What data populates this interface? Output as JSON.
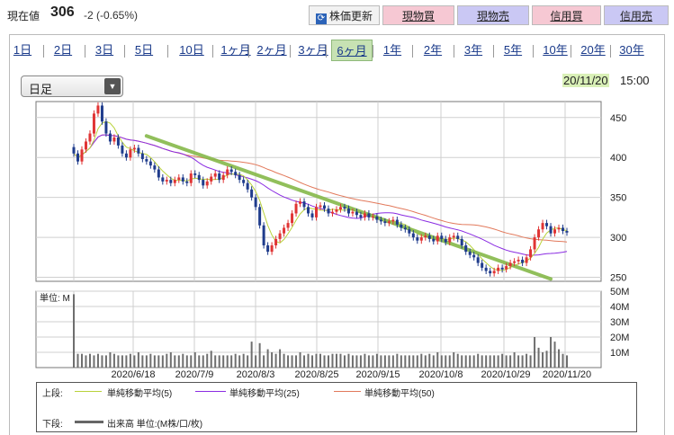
{
  "quote": {
    "price_label": "現在値",
    "price": "306",
    "change": "-2 (-0.65%)"
  },
  "toolbar": {
    "refresh_label": "株価更新",
    "refresh_icon": "refresh-icon",
    "cash_buy": "現物買",
    "cash_sell": "現物売",
    "margin_buy": "信用買",
    "margin_sell": "信用売"
  },
  "periods": [
    "1日",
    "2日",
    "3日",
    "5日",
    "10日",
    "1ヶ月",
    "2ヶ月",
    "3ヶ月",
    "6ヶ月",
    "1年",
    "2年",
    "3年",
    "5年",
    "10年",
    "20年",
    "30年"
  ],
  "active_period": "6ヶ月",
  "candle_select": {
    "value": "日足",
    "icon": "dropdown-arrow-icon"
  },
  "timestamp": {
    "date": "20/11/20",
    "time": "15:00"
  },
  "colors": {
    "up": "#e03434",
    "down": "#1f3c8c",
    "ma5": "#b9d23a",
    "ma25": "#8a2be2",
    "ma50": "#e2795b",
    "trend": "#86b94a",
    "volume": "#6e6e6e"
  },
  "chart_data": {
    "type": "candlestick",
    "price_axis": {
      "ticks": [
        250,
        300,
        350,
        400,
        450
      ],
      "range": [
        245,
        470
      ]
    },
    "volume_axis": {
      "unit_label": "単位: M",
      "ticks": [
        "10M",
        "20M",
        "30M",
        "40M",
        "50M"
      ],
      "range": [
        0,
        50
      ]
    },
    "x_labels": [
      "2020/6/18",
      "2020/7/9",
      "2020/8/3",
      "2020/8/25",
      "2020/9/15",
      "2020/10/8",
      "2020/10/29",
      "2020/11/20"
    ],
    "closes": [
      405,
      395,
      410,
      420,
      430,
      455,
      465,
      445,
      430,
      420,
      425,
      415,
      405,
      400,
      410,
      412,
      405,
      398,
      395,
      390,
      385,
      375,
      370,
      372,
      368,
      372,
      375,
      370,
      368,
      380,
      378,
      372,
      365,
      370,
      376,
      380,
      372,
      378,
      385,
      382,
      378,
      372,
      368,
      360,
      350,
      338,
      315,
      290,
      282,
      290,
      298,
      305,
      312,
      318,
      330,
      342,
      345,
      338,
      330,
      325,
      338,
      340,
      336,
      330,
      332,
      335,
      338,
      336,
      330,
      332,
      328,
      325,
      330,
      325,
      326,
      322,
      320,
      318,
      320,
      322,
      316,
      312,
      310,
      305,
      300,
      296,
      300,
      302,
      298,
      295,
      302,
      298,
      294,
      300,
      302,
      298,
      290,
      282,
      278,
      275,
      268,
      262,
      258,
      255,
      258,
      262,
      260,
      264,
      268,
      270,
      272,
      268,
      275,
      285,
      300,
      310,
      318,
      314,
      305,
      310,
      312,
      308,
      306
    ],
    "volumes": [
      48,
      9,
      9,
      8,
      9,
      8,
      9,
      8,
      8,
      10,
      9,
      8,
      8,
      8,
      9,
      8,
      10,
      8,
      8,
      9,
      8,
      8,
      8,
      9,
      10,
      8,
      8,
      9,
      8,
      8,
      10,
      8,
      8,
      9,
      11,
      8,
      8,
      8,
      8,
      8,
      9,
      8,
      9,
      8,
      17,
      8,
      16,
      8,
      12,
      10,
      9,
      12,
      9,
      8,
      8,
      8,
      10,
      8,
      9,
      8,
      9,
      9,
      8,
      8,
      9,
      9,
      9,
      8,
      9,
      8,
      8,
      8,
      9,
      8,
      8,
      9,
      8,
      8,
      8,
      8,
      9,
      8,
      8,
      8,
      8,
      8,
      9,
      8,
      9,
      8,
      10,
      8,
      8,
      8,
      10,
      9,
      8,
      8,
      8,
      8,
      9,
      8,
      8,
      8,
      8,
      8,
      9,
      8,
      8,
      10,
      8,
      8,
      9,
      8,
      20,
      13,
      10,
      11,
      20,
      17,
      12,
      9,
      8
    ],
    "moving_averages": [
      {
        "name": "単純移動平均(5)"
      },
      {
        "name": "単純移動平均(25)"
      },
      {
        "name": "単純移動平均(50)"
      }
    ],
    "trendline": {
      "from": {
        "bar": 18,
        "value": 427
      },
      "to": {
        "bar": 118,
        "value": 248
      }
    }
  },
  "legend": {
    "upper_label": "上段:",
    "lower_label": "下段:",
    "ma5": "単純移動平均(5)",
    "ma25": "単純移動平均(25)",
    "ma50": "単純移動平均(50)",
    "volume": "出来高 単位:(M株/口/枚)"
  }
}
